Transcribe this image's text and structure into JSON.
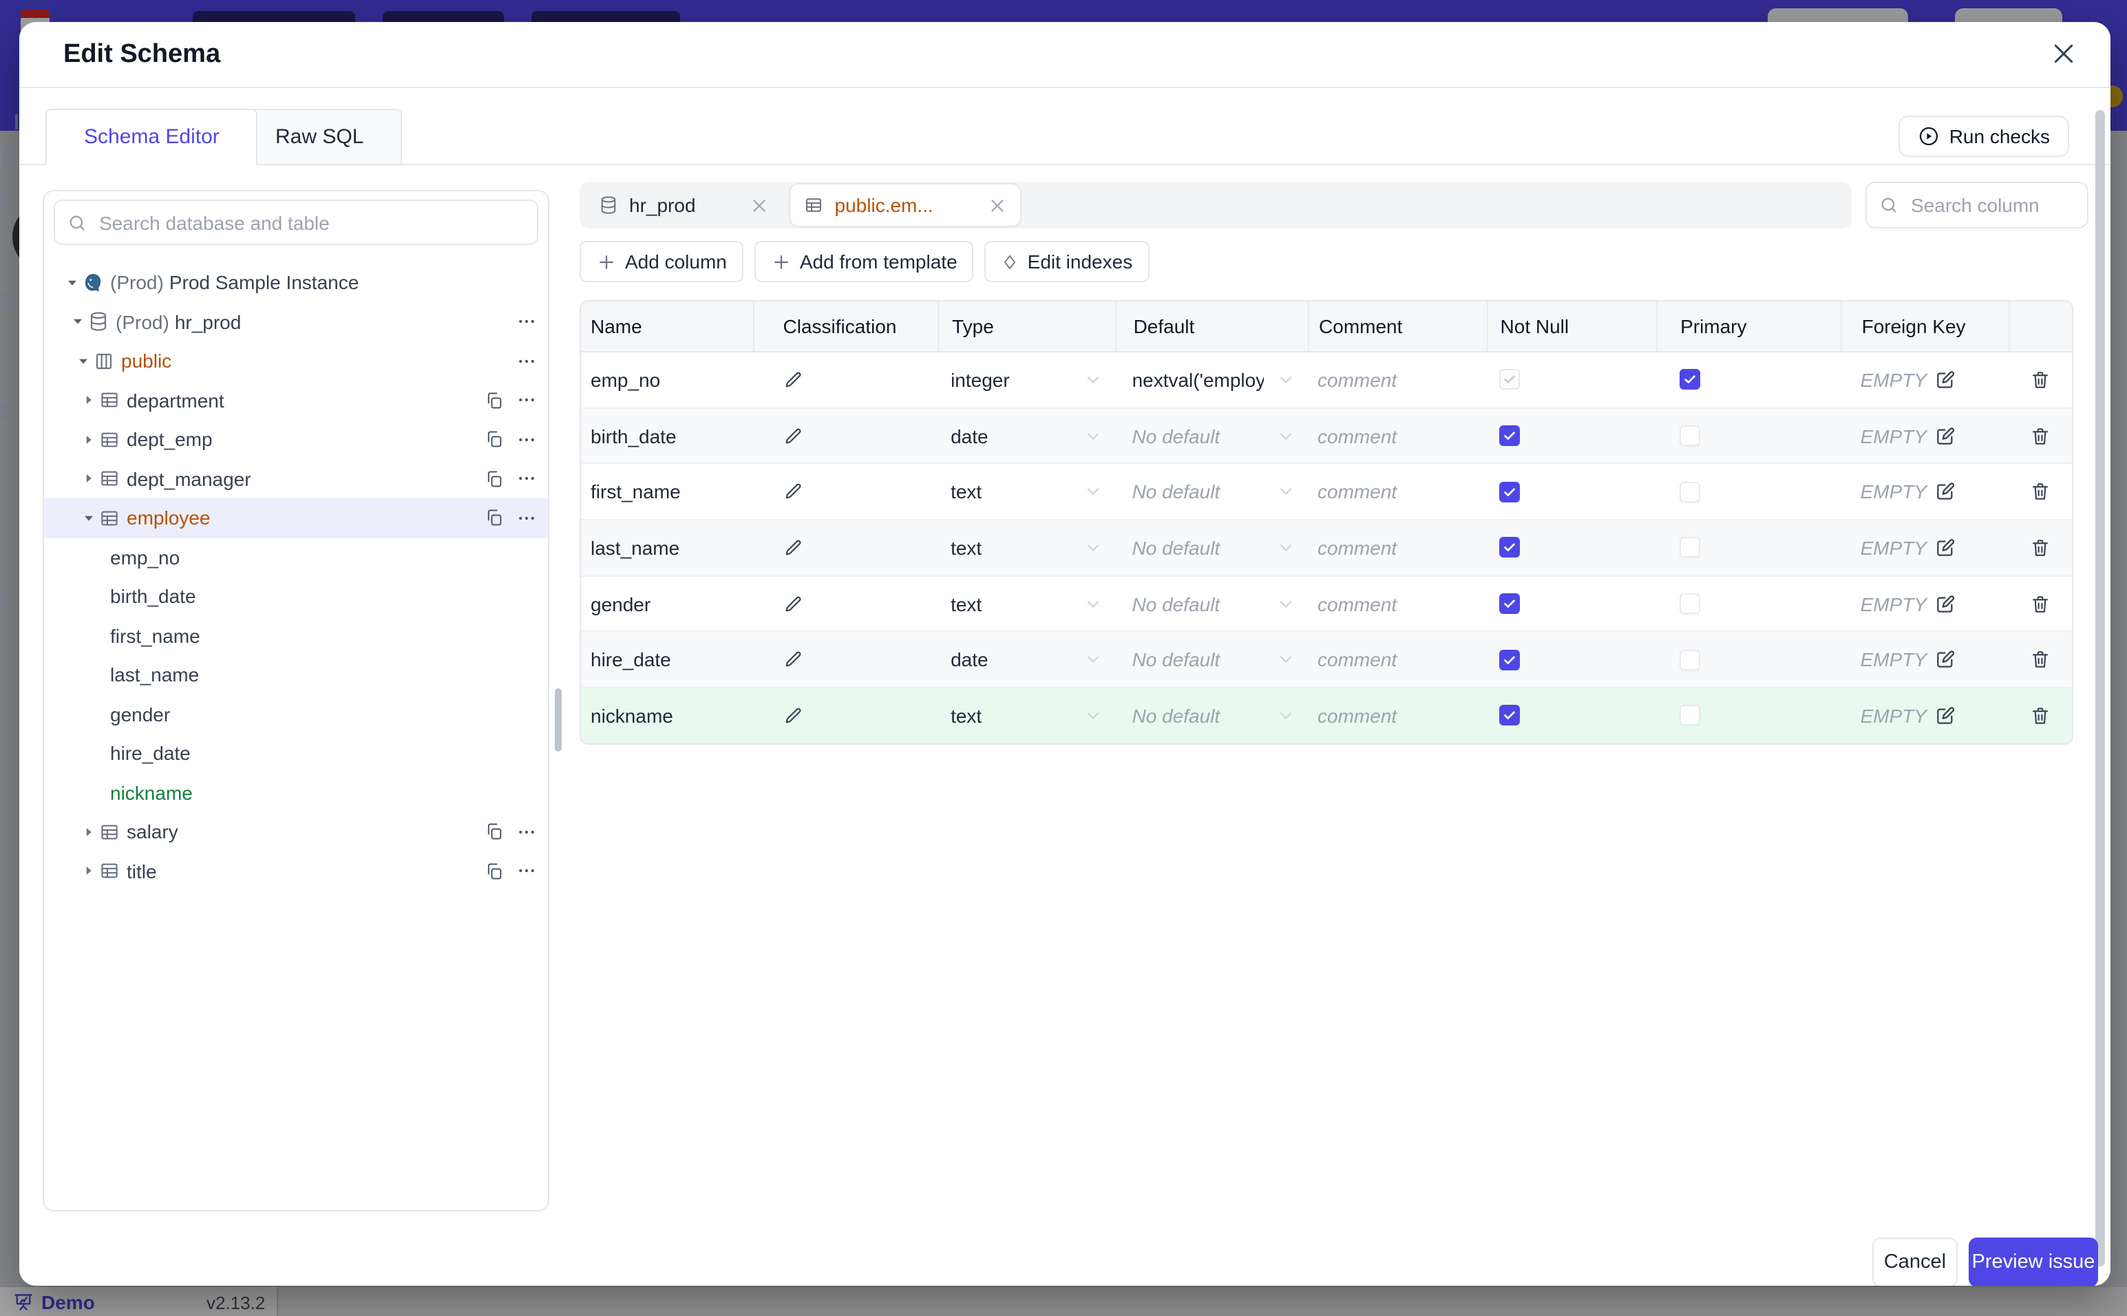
{
  "app": {
    "brand": "Demo",
    "version": "v2.13.2"
  },
  "modal": {
    "title": "Edit Schema",
    "tabs": [
      {
        "label": "Schema Editor",
        "active": true
      },
      {
        "label": "Raw SQL",
        "active": false
      }
    ],
    "run_checks_label": "Run checks",
    "footer": {
      "cancel_label": "Cancel",
      "primary_label": "Preview issue"
    }
  },
  "sidebar": {
    "search_placeholder": "Search database and table",
    "tree": [
      {
        "level": 0,
        "expand": "open",
        "icon": "postgres-icon",
        "prefix": "(Prod)",
        "label": "Prod Sample Instance",
        "actions": []
      },
      {
        "level": 1,
        "expand": "open",
        "icon": "database-icon",
        "prefix": "(Prod)",
        "label": "hr_prod",
        "actions": [
          "more"
        ]
      },
      {
        "level": 2,
        "expand": "open",
        "icon": "schema-icon",
        "label": "public",
        "state": "modified",
        "actions": [
          "more"
        ]
      },
      {
        "level": 3,
        "expand": "closed",
        "icon": "table-icon",
        "label": "department",
        "actions": [
          "copy",
          "more"
        ]
      },
      {
        "level": 3,
        "expand": "closed",
        "icon": "table-icon",
        "label": "dept_emp",
        "actions": [
          "copy",
          "more"
        ]
      },
      {
        "level": 3,
        "expand": "closed",
        "icon": "table-icon",
        "label": "dept_manager",
        "actions": [
          "copy",
          "more"
        ]
      },
      {
        "level": 3,
        "expand": "open",
        "icon": "table-icon",
        "label": "employee",
        "state": "modified",
        "selected": true,
        "actions": [
          "copy",
          "more"
        ]
      },
      {
        "level": 4,
        "label": "emp_no"
      },
      {
        "level": 4,
        "label": "birth_date"
      },
      {
        "level": 4,
        "label": "first_name"
      },
      {
        "level": 4,
        "label": "last_name"
      },
      {
        "level": 4,
        "label": "gender"
      },
      {
        "level": 4,
        "label": "hire_date"
      },
      {
        "level": 4,
        "label": "nickname",
        "state": "new"
      },
      {
        "level": 3,
        "expand": "closed",
        "icon": "table-icon",
        "label": "salary",
        "actions": [
          "copy",
          "more"
        ]
      },
      {
        "level": 3,
        "expand": "closed",
        "icon": "table-icon",
        "label": "title",
        "actions": [
          "copy",
          "more"
        ]
      }
    ]
  },
  "editor": {
    "chips": [
      {
        "icon": "database-icon",
        "label": "hr_prod",
        "selected": false
      },
      {
        "icon": "table-icon",
        "label": "public.em...",
        "selected": true,
        "state": "modified"
      }
    ],
    "column_search_placeholder": "Search column",
    "toolbar": [
      {
        "icon": "plus-icon",
        "label": "Add column"
      },
      {
        "icon": "plus-icon",
        "label": "Add from template"
      },
      {
        "icon": "diamond-icon",
        "label": "Edit indexes"
      }
    ],
    "table": {
      "headers": [
        "Name",
        "Classification",
        "Type",
        "Default",
        "Comment",
        "Not Null",
        "Primary",
        "Foreign Key",
        ""
      ],
      "comment_placeholder": "comment",
      "no_default_label": "No default",
      "fk_empty_label": "EMPTY",
      "rows": [
        {
          "name": "emp_no",
          "type": "integer",
          "default": "nextval('employ",
          "has_default": true,
          "not_null": "checked-disabled",
          "primary": "checked",
          "row_state": "normal"
        },
        {
          "name": "birth_date",
          "type": "date",
          "default": "",
          "has_default": false,
          "not_null": "checked",
          "primary": "unchecked",
          "row_state": "normal"
        },
        {
          "name": "first_name",
          "type": "text",
          "default": "",
          "has_default": false,
          "not_null": "checked",
          "primary": "unchecked",
          "row_state": "normal"
        },
        {
          "name": "last_name",
          "type": "text",
          "default": "",
          "has_default": false,
          "not_null": "checked",
          "primary": "unchecked",
          "row_state": "normal"
        },
        {
          "name": "gender",
          "type": "text",
          "default": "",
          "has_default": false,
          "not_null": "checked",
          "primary": "unchecked",
          "row_state": "normal"
        },
        {
          "name": "hire_date",
          "type": "date",
          "default": "",
          "has_default": false,
          "not_null": "checked",
          "primary": "unchecked",
          "row_state": "normal"
        },
        {
          "name": "nickname",
          "type": "text",
          "default": "",
          "has_default": false,
          "not_null": "checked",
          "primary": "unchecked",
          "row_state": "new"
        }
      ]
    }
  },
  "colors": {
    "accent": "#4f46e5",
    "modified_text": "#b45309",
    "new_text": "#15803d",
    "new_row_bg": "#e9f9ef",
    "selected_tree_row_bg": "#edeefc",
    "topbar": "#4f46e5"
  }
}
